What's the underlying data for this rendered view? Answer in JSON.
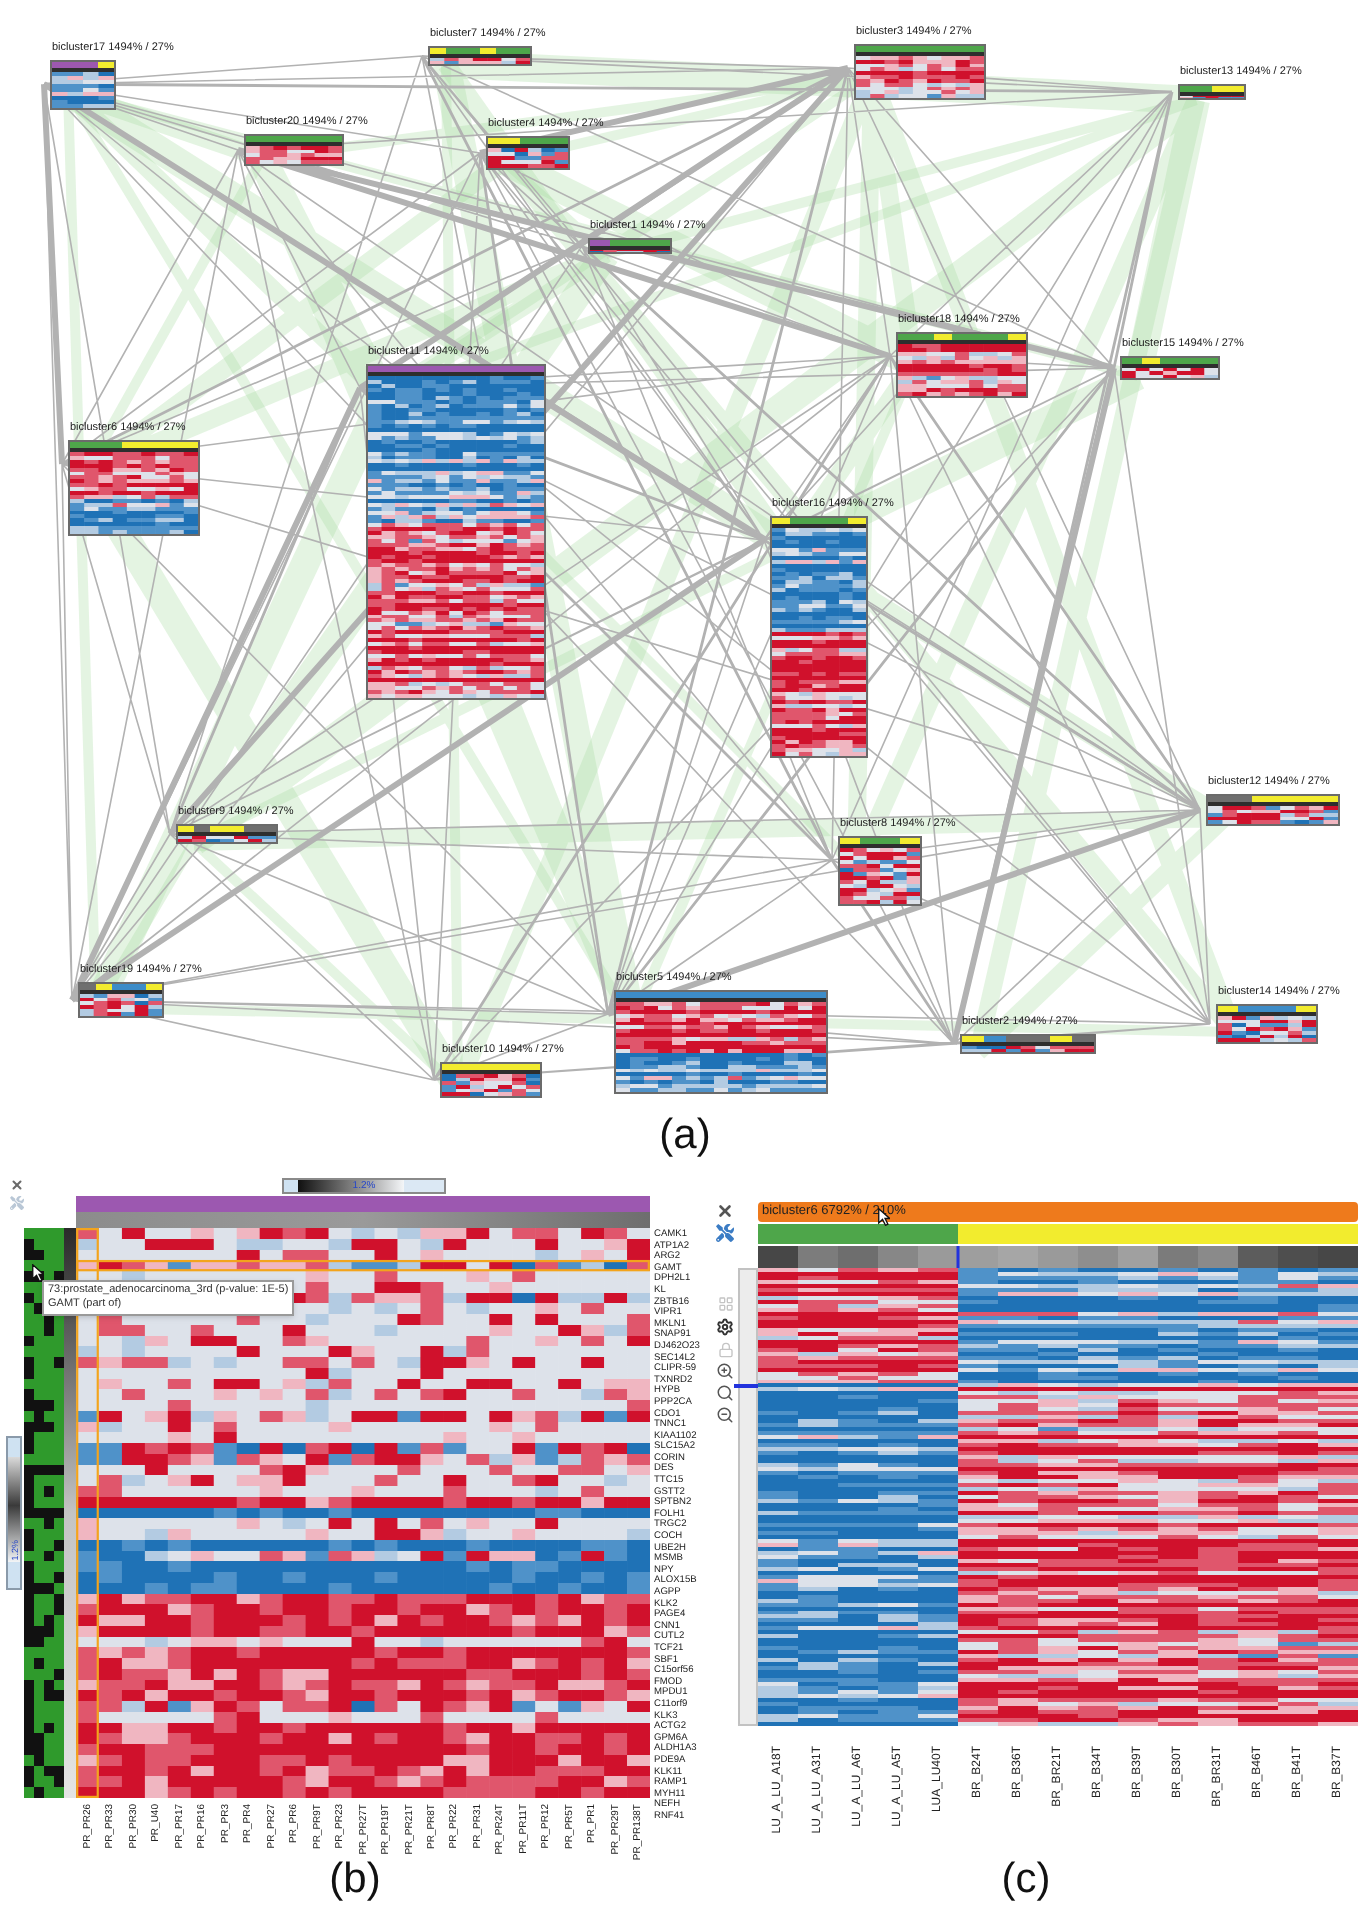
{
  "panel_a": {
    "nodes": [
      {
        "label": "bicluster7 1494% / 27%",
        "kind": "mixed",
        "samples": [
          {
            "color": "#f2ec2e"
          },
          {
            "color": "#4ea64a"
          },
          {
            "color": "#4ea64a"
          },
          {
            "color": "#f2ec2e"
          },
          {
            "color": "#4ea64a"
          },
          {
            "color": "#4ea64a"
          }
        ]
      },
      {
        "label": "bicluster3 1494% / 27%",
        "kind": "warm",
        "samples": [
          {
            "color": "#4ea64a"
          },
          {
            "color": "#4ea64a"
          },
          {
            "color": "#4ea64a"
          }
        ]
      },
      {
        "label": "bicluster17 1494% / 27%",
        "kind": "cool",
        "samples": [
          {
            "color": "#9c58b0"
          },
          {
            "color": "#9c58b0"
          },
          {
            "color": "#9c58b0"
          },
          {
            "color": "#f2ec2e"
          }
        ]
      },
      {
        "label": "bicluster13 1494% / 27%",
        "kind": "mixed",
        "samples": [
          {
            "color": "#4ea64a"
          },
          {
            "color": "#f2ec2e"
          }
        ]
      },
      {
        "label": "bicluster20 1494% / 27%",
        "kind": "warm",
        "samples": [
          {
            "color": "#4ea64a"
          },
          {
            "color": "#4ea64a"
          },
          {
            "color": "#4ea64a"
          }
        ]
      },
      {
        "label": "bicluster4 1494% / 27%",
        "kind": "mixed",
        "samples": [
          {
            "color": "#f2ec2e"
          },
          {
            "color": "#f2ec2e"
          },
          {
            "color": "#4ea64a"
          },
          {
            "color": "#4ea64a"
          },
          {
            "color": "#4ea64a"
          }
        ]
      },
      {
        "label": "bicluster1 1494% / 27%",
        "kind": "mixed",
        "samples": [
          {
            "color": "#9c58b0"
          },
          {
            "color": "#4ea64a"
          },
          {
            "color": "#4ea64a"
          },
          {
            "color": "#4ea64a"
          }
        ]
      },
      {
        "label": "bicluster18 1494% / 27%",
        "kind": "warm",
        "samples": [
          {
            "color": "#4ea64a"
          },
          {
            "color": "#4ea64a"
          },
          {
            "color": "#f2ec2e"
          },
          {
            "color": "#4ea64a"
          },
          {
            "color": "#4ea64a"
          },
          {
            "color": "#4ea64a"
          },
          {
            "color": "#f2ec2e"
          }
        ]
      },
      {
        "label": "bicluster11 1494% / 27%",
        "kind": "cooltop",
        "samples": [
          {
            "color": "#9c58b0"
          },
          {
            "color": "#9c58b0"
          },
          {
            "color": "#9c58b0"
          }
        ]
      },
      {
        "label": "bicluster15 1494% / 27%",
        "kind": "mixed",
        "samples": [
          {
            "color": "#4ea64a"
          },
          {
            "color": "#f2ec2e"
          },
          {
            "color": "#4ea64a"
          },
          {
            "color": "#4ea64a"
          },
          {
            "color": "#4ea64a"
          }
        ]
      },
      {
        "label": "bicluster6 1494% / 27%",
        "kind": "warmtop",
        "samples": [
          {
            "color": "#4ea64a"
          },
          {
            "color": "#4ea64a"
          },
          {
            "color": "#f2ec2e"
          },
          {
            "color": "#f2ec2e"
          },
          {
            "color": "#f2ec2e"
          }
        ]
      },
      {
        "label": "bicluster16 1494% / 27%",
        "kind": "cooltop",
        "samples": [
          {
            "color": "#f2ec2e"
          },
          {
            "color": "#4ea64a"
          },
          {
            "color": "#4ea64a"
          },
          {
            "color": "#4ea64a"
          },
          {
            "color": "#f2ec2e"
          }
        ]
      },
      {
        "label": "bicluster12 1494% / 27%",
        "kind": "mixed",
        "samples": [
          {
            "color": "#6f6f6f"
          },
          {
            "color": "#f2ec2e"
          },
          {
            "color": "#f2ec2e"
          }
        ]
      },
      {
        "label": "bicluster9 1494% / 27%",
        "kind": "mixed",
        "samples": [
          {
            "color": "#f2ec2e"
          },
          {
            "color": "#6f6f6f"
          },
          {
            "color": "#f2ec2e"
          },
          {
            "color": "#f2ec2e"
          },
          {
            "color": "#6f6f6f"
          },
          {
            "color": "#6f6f6f"
          }
        ]
      },
      {
        "label": "bicluster8 1494% / 27%",
        "kind": "mixed",
        "samples": [
          {
            "color": "#f2ec2e"
          },
          {
            "color": "#4ea64a"
          },
          {
            "color": "#4ea64a"
          },
          {
            "color": "#f2ec2e"
          }
        ]
      },
      {
        "label": "bicluster19 1494% / 27%",
        "kind": "mixed",
        "samples": [
          {
            "color": "#6f6f6f"
          },
          {
            "color": "#f2ec2e"
          },
          {
            "color": "#3d8cc8"
          },
          {
            "color": "#3d8cc8"
          },
          {
            "color": "#f2ec2e"
          }
        ]
      },
      {
        "label": "bicluster5 1494% / 27%",
        "kind": "warmtop",
        "samples": [
          {
            "color": "#3d8cc8"
          },
          {
            "color": "#3d8cc8"
          },
          {
            "color": "#3d8cc8"
          }
        ]
      },
      {
        "label": "bicluster14 1494% / 27%",
        "kind": "mixed",
        "samples": [
          {
            "color": "#f2ec2e"
          },
          {
            "color": "#3d8cc8"
          },
          {
            "color": "#3d8cc8"
          },
          {
            "color": "#3d8cc8"
          },
          {
            "color": "#f2ec2e"
          }
        ]
      },
      {
        "label": "bicluster2 1494% / 27%",
        "kind": "mixed",
        "samples": [
          {
            "color": "#f2ec2e"
          },
          {
            "color": "#3d8cc8"
          },
          {
            "color": "#6f6f6f"
          },
          {
            "color": "#6f6f6f"
          },
          {
            "color": "#f2ec2e"
          },
          {
            "color": "#6f6f6f"
          }
        ]
      },
      {
        "label": "bicluster10 1494% / 27%",
        "kind": "mixed",
        "samples": [
          {
            "color": "#f2ec2e"
          },
          {
            "color": "#f2ec2e"
          },
          {
            "color": "#f2ec2e"
          }
        ]
      }
    ],
    "caption": "(a)"
  },
  "panel_b": {
    "scale_label": "1.2%",
    "side_scale_label": "1.2%",
    "tooltip": {
      "title": "73:prostate_adenocarcinoma_3rd (p-value: 1E-5)",
      "detail": "GAMT (part of)"
    },
    "groups": [
      {
        "color": "#9c58b0",
        "columns": [
          {
            "label": "PR_PR26",
            "selected": true
          },
          {
            "label": "PR_PR33",
            "selected": false
          },
          {
            "label": "PR_PR30",
            "selected": false
          },
          {
            "label": "PR_U40",
            "selected": false
          },
          {
            "label": "PR_PR17",
            "selected": false
          },
          {
            "label": "PR_PR16",
            "selected": false
          },
          {
            "label": "PR_PR3",
            "selected": false
          },
          {
            "label": "PR_PR4",
            "selected": false
          },
          {
            "label": "PR_PR27",
            "selected": false
          },
          {
            "label": "PR_PR6",
            "selected": false
          },
          {
            "label": "PR_PR9T",
            "selected": false
          },
          {
            "label": "PR_PR23",
            "selected": false
          },
          {
            "label": "PR_PR27T",
            "selected": false
          },
          {
            "label": "PR_PR19T",
            "selected": false
          },
          {
            "label": "PR_PR21T",
            "selected": false
          },
          {
            "label": "PR_PR8T",
            "selected": false
          },
          {
            "label": "PR_PR22",
            "selected": false
          },
          {
            "label": "PR_PR31",
            "selected": false
          },
          {
            "label": "PR_PR24T",
            "selected": false
          },
          {
            "label": "PR_PR11T",
            "selected": false
          },
          {
            "label": "PR_PR12",
            "selected": false
          },
          {
            "label": "PR_PR5T",
            "selected": false
          },
          {
            "label": "PR_PR1",
            "selected": false
          },
          {
            "label": "PR_PR29T",
            "selected": false
          },
          {
            "label": "PR_PR138T",
            "selected": false
          }
        ]
      }
    ],
    "genes": [
      {
        "name": "CAMK1",
        "kind": "pale",
        "selected": false
      },
      {
        "name": "ATP1A2",
        "kind": "pale",
        "selected": false
      },
      {
        "name": "ARG2",
        "kind": "pale",
        "selected": false
      },
      {
        "name": "GAMT",
        "kind": "mixed",
        "selected": true
      },
      {
        "name": "DPH2L1",
        "kind": "pale",
        "selected": false
      },
      {
        "name": "KL",
        "kind": "pale",
        "selected": false
      },
      {
        "name": "ZBTB16",
        "kind": "mixed",
        "selected": false
      },
      {
        "name": "VIPR1",
        "kind": "pale",
        "selected": false
      },
      {
        "name": "MKLN1",
        "kind": "pale",
        "selected": false
      },
      {
        "name": "SNAP91",
        "kind": "pale",
        "selected": false
      },
      {
        "name": "DJ462O23",
        "kind": "pale",
        "selected": false
      },
      {
        "name": "SEC14L2",
        "kind": "pale",
        "selected": false
      },
      {
        "name": "CLIPR-59",
        "kind": "pale",
        "selected": false
      },
      {
        "name": "TXNRD2",
        "kind": "pale",
        "selected": false
      },
      {
        "name": "HYPB",
        "kind": "pale",
        "selected": false
      },
      {
        "name": "PPP2CA",
        "kind": "pale",
        "selected": false
      },
      {
        "name": "CDO1",
        "kind": "pale",
        "selected": false
      },
      {
        "name": "TNNC1",
        "kind": "mixed",
        "selected": false
      },
      {
        "name": "KIAA1102",
        "kind": "pale",
        "selected": false
      },
      {
        "name": "SLC15A2",
        "kind": "pale",
        "selected": false
      },
      {
        "name": "CORIN",
        "kind": "mixed",
        "selected": false
      },
      {
        "name": "DES",
        "kind": "mixed",
        "selected": false
      },
      {
        "name": "TTC15",
        "kind": "pale",
        "selected": false
      },
      {
        "name": "GSTT2",
        "kind": "pale",
        "selected": false
      },
      {
        "name": "SPTBN2",
        "kind": "pale",
        "selected": false
      },
      {
        "name": "FOLH1",
        "kind": "red",
        "selected": false
      },
      {
        "name": "TRGC2",
        "kind": "blue",
        "selected": false
      },
      {
        "name": "COCH",
        "kind": "pale",
        "selected": false
      },
      {
        "name": "UBE2H",
        "kind": "pale",
        "selected": false
      },
      {
        "name": "MSMB",
        "kind": "blue",
        "selected": false
      },
      {
        "name": "NPY",
        "kind": "mixed",
        "selected": false
      },
      {
        "name": "ALOX15B",
        "kind": "blue",
        "selected": false
      },
      {
        "name": "AGPP",
        "kind": "blue",
        "selected": false
      },
      {
        "name": "KLK2",
        "kind": "blue",
        "selected": false
      },
      {
        "name": "PAGE4",
        "kind": "red",
        "selected": false
      },
      {
        "name": "CNN1",
        "kind": "red",
        "selected": false
      },
      {
        "name": "CUTL2",
        "kind": "red",
        "selected": false
      },
      {
        "name": "TCF21",
        "kind": "red",
        "selected": false
      },
      {
        "name": "SBF1",
        "kind": "pale",
        "selected": false
      },
      {
        "name": "C15orf56",
        "kind": "red",
        "selected": false
      },
      {
        "name": "FMOD",
        "kind": "red",
        "selected": false
      },
      {
        "name": "MPDU1",
        "kind": "red",
        "selected": false
      },
      {
        "name": "C11orf9",
        "kind": "red",
        "selected": false
      },
      {
        "name": "KLK3",
        "kind": "red",
        "selected": false
      },
      {
        "name": "ACTG2",
        "kind": "mixed",
        "selected": false
      },
      {
        "name": "GPM6A",
        "kind": "pale",
        "selected": false
      },
      {
        "name": "ALDH1A3",
        "kind": "red",
        "selected": false
      },
      {
        "name": "PDE9A",
        "kind": "red",
        "selected": false
      },
      {
        "name": "KLK11",
        "kind": "red",
        "selected": false
      },
      {
        "name": "RAMP1",
        "kind": "red",
        "selected": false
      },
      {
        "name": "MYH11",
        "kind": "red",
        "selected": false
      },
      {
        "name": "NEFH",
        "kind": "red",
        "selected": false
      },
      {
        "name": "RNF41",
        "kind": "red",
        "selected": false
      }
    ],
    "caption": "(b)"
  },
  "panel_c": {
    "title": "bicluster6 6792% / 210%",
    "groups": [
      {
        "color": "#4ea64a",
        "columns": [
          {
            "label": "LU_A_LU_A18T",
            "kind": "redtop"
          },
          {
            "label": "LU_A_LU_A31T",
            "kind": "redtop"
          },
          {
            "label": "LU_A_LU_A6T",
            "kind": "redtop"
          },
          {
            "label": "LU_A_LU_A5T",
            "kind": "redtop"
          },
          {
            "label": "LUA_LU40T",
            "kind": "redtop"
          }
        ]
      },
      {
        "color": "#f2ec2e",
        "columns": [
          {
            "label": "BR_B24T",
            "kind": "bluetop"
          },
          {
            "label": "BR_B36T",
            "kind": "bluetop"
          },
          {
            "label": "BR_BR21T",
            "kind": "bluetop"
          },
          {
            "label": "BR_B34T",
            "kind": "bluetop"
          },
          {
            "label": "BR_B39T",
            "kind": "bluetop"
          },
          {
            "label": "BR_B30T",
            "kind": "bluetop"
          },
          {
            "label": "BR_BR31T",
            "kind": "bluetop"
          },
          {
            "label": "BR_B46T",
            "kind": "bluetop"
          },
          {
            "label": "BR_B41T",
            "kind": "bluetop"
          },
          {
            "label": "BR_B37T",
            "kind": "bluetop"
          }
        ]
      }
    ],
    "caption": "(c)"
  }
}
